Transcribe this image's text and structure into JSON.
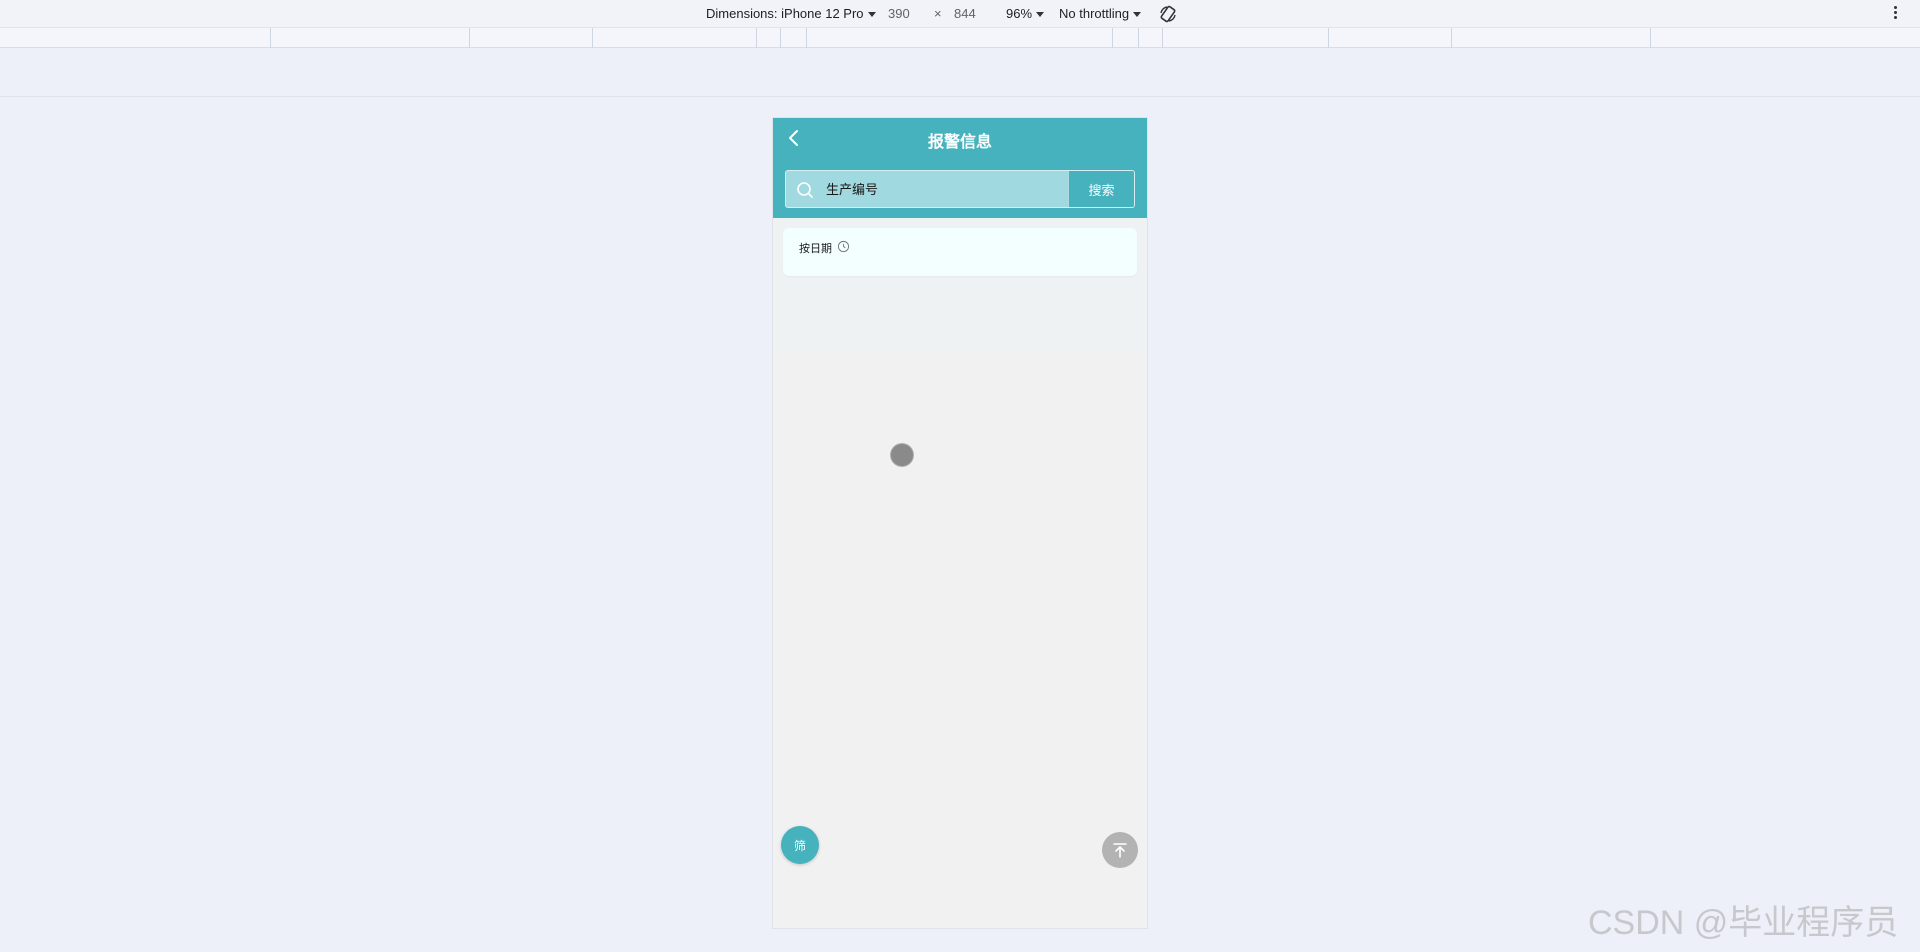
{
  "devtools": {
    "dimensions_label": "Dimensions: iPhone 12 Pro",
    "width_value": "390",
    "times_symbol": "×",
    "height_value": "844",
    "zoom": "96%",
    "throttling": "No throttling"
  },
  "app": {
    "header_title": "报警信息",
    "search": {
      "placeholder": "生产编号",
      "button_label": "搜索"
    },
    "date_filter": {
      "label": "按日期"
    },
    "filter_button_label": "筛",
    "accent_color": "#45b2bd"
  },
  "watermark": "CSDN @毕业程序员"
}
